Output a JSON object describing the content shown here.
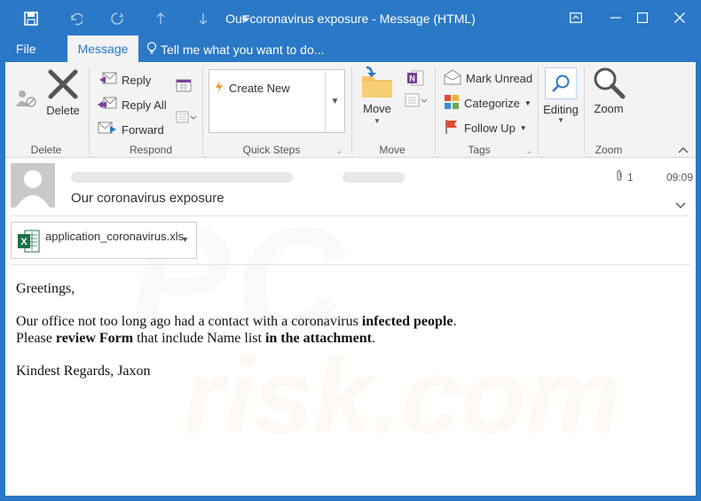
{
  "window": {
    "title": "Our coronavirus exposure - Message (HTML)"
  },
  "tabs": {
    "file": "File",
    "message": "Message",
    "tell_me": "Tell me what you want to do..."
  },
  "ribbon": {
    "delete_group": {
      "label": "Delete",
      "delete_button": "Delete"
    },
    "respond_group": {
      "label": "Respond",
      "reply": "Reply",
      "reply_all": "Reply All",
      "forward": "Forward"
    },
    "quick_steps_group": {
      "label": "Quick Steps",
      "create_new": "Create New"
    },
    "move_group": {
      "label": "Move",
      "move_button": "Move"
    },
    "tags_group": {
      "label": "Tags",
      "mark_unread": "Mark Unread",
      "categorize": "Categorize",
      "follow_up": "Follow Up"
    },
    "editing_group": {
      "editing_button": "Editing"
    },
    "zoom_group": {
      "label": "Zoom",
      "zoom_button": "Zoom"
    }
  },
  "message": {
    "subject": "Our coronavirus exposure",
    "attachment_count": "1",
    "time": "09:09",
    "attachment": {
      "name": "application_coronavirus.xls"
    },
    "body": {
      "greeting": "Greetings,",
      "line1_a": "Our office not too long ago had a contact with a coronavirus ",
      "line1_b": "infected people",
      "line1_c": ".",
      "line2_a": "Please ",
      "line2_b": "review Form",
      "line2_c": " that include Name list ",
      "line2_d": "in the attachment",
      "line2_e": ".",
      "signoff": "Kindest Regards, Jaxon"
    }
  },
  "colors": {
    "accent": "#2b78c6",
    "ribbon_bg": "#f3f3f3",
    "excel_green": "#1e7145"
  },
  "icons": {
    "save": "save-icon",
    "undo": "undo-icon",
    "redo": "redo-icon",
    "attachment": "paperclip-icon"
  }
}
